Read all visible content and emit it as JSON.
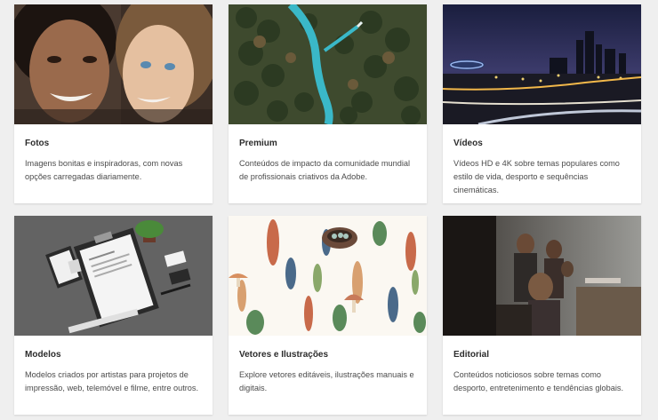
{
  "categories": [
    {
      "title": "Fotos",
      "description": "Imagens bonitas e inspiradoras, com novas opções carregadas diariamente.",
      "thumbnail": "two-women-smiling-photo"
    },
    {
      "title": "Premium",
      "description": "Conteúdos de impacto da comunidade mundial de profissionais criativos da Adobe.",
      "thumbnail": "aerial-river-forest-photo"
    },
    {
      "title": "Vídeos",
      "description": "Vídeos HD e 4K sobre temas populares como estilo de vida, desporto e sequências cinemáticas.",
      "thumbnail": "night-city-skyline-photo"
    },
    {
      "title": "Modelos",
      "description": "Modelos criados por artistas para projetos de impressão, web, telemóvel e filme, entre outros.",
      "thumbnail": "stationery-mockup-photo"
    },
    {
      "title": "Vetores e Ilustrações",
      "description": "Explore vetores editáveis, ilustrações manuais e digitais.",
      "thumbnail": "botanical-pattern-illustration"
    },
    {
      "title": "Editorial",
      "description": "Conteúdos noticiosos sobre temas como desporto, entretenimento e tendências globais.",
      "thumbnail": "children-news-photo"
    }
  ]
}
